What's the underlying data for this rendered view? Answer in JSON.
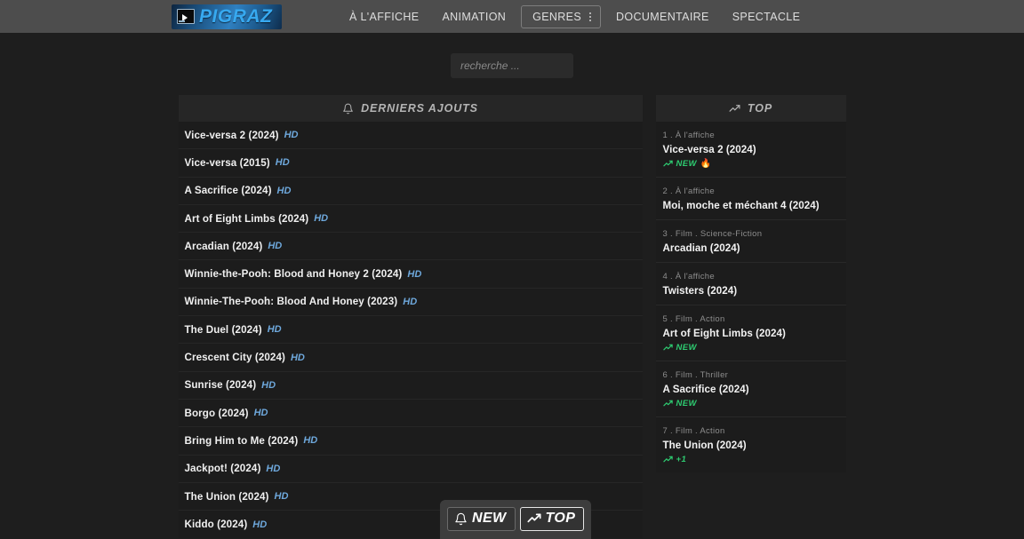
{
  "header": {
    "logo": {
      "text": "PIGRAZ",
      "icon": "monitor-play-icon"
    },
    "nav": [
      {
        "label": "À L'AFFICHE",
        "boxed": false
      },
      {
        "label": "ANIMATION",
        "boxed": false
      },
      {
        "label": "GENRES",
        "boxed": true,
        "icon": "kebab-menu-icon"
      },
      {
        "label": "DOCUMENTAIRE",
        "boxed": false
      },
      {
        "label": "SPECTACLE",
        "boxed": false
      }
    ]
  },
  "search": {
    "value": "",
    "placeholder": "recherche ..."
  },
  "latest": {
    "heading": "DERNIERS AJOUTS",
    "heading_icon": "bell-icon",
    "items": [
      {
        "title": "Vice-versa 2 (2024)",
        "quality": "HD"
      },
      {
        "title": "Vice-versa (2015)",
        "quality": "HD"
      },
      {
        "title": "A Sacrifice (2024)",
        "quality": "HD"
      },
      {
        "title": "Art of Eight Limbs (2024)",
        "quality": "HD"
      },
      {
        "title": "Arcadian (2024)",
        "quality": "HD"
      },
      {
        "title": "Winnie-the-Pooh: Blood and Honey 2 (2024)",
        "quality": "HD"
      },
      {
        "title": "Winnie-The-Pooh: Blood And Honey (2023)",
        "quality": "HD"
      },
      {
        "title": "The Duel (2024)",
        "quality": "HD"
      },
      {
        "title": "Crescent City (2024)",
        "quality": "HD"
      },
      {
        "title": "Sunrise (2024)",
        "quality": "HD"
      },
      {
        "title": "Borgo (2024)",
        "quality": "HD"
      },
      {
        "title": "Bring Him to Me (2024)",
        "quality": "HD"
      },
      {
        "title": "Jackpot! (2024)",
        "quality": "HD"
      },
      {
        "title": "The Union (2024)",
        "quality": "HD"
      },
      {
        "title": "Kiddo (2024)",
        "quality": "HD"
      }
    ]
  },
  "top": {
    "heading": "TOP",
    "heading_icon": "trending-up-icon",
    "items": [
      {
        "meta": "1 . À l'affiche",
        "title": "Vice-versa 2 (2024)",
        "badge": "NEW",
        "badge_icon": "trending-up-icon",
        "fire": "🔥"
      },
      {
        "meta": "2 . À l'affiche",
        "title": "Moi, moche et méchant 4 (2024)",
        "badge": "",
        "badge_icon": "",
        "fire": ""
      },
      {
        "meta": "3 . Film . Science-Fiction",
        "title": "Arcadian (2024)",
        "badge": "",
        "badge_icon": "",
        "fire": ""
      },
      {
        "meta": "4 . À l'affiche",
        "title": "Twisters (2024)",
        "badge": "",
        "badge_icon": "",
        "fire": ""
      },
      {
        "meta": "5 . Film . Action",
        "title": "Art of Eight Limbs (2024)",
        "badge": "NEW",
        "badge_icon": "trending-up-icon",
        "fire": ""
      },
      {
        "meta": "6 . Film . Thriller",
        "title": "A Sacrifice (2024)",
        "badge": "NEW",
        "badge_icon": "trending-up-icon",
        "fire": ""
      },
      {
        "meta": "7 . Film . Action",
        "title": "The Union (2024)",
        "badge": "+1",
        "badge_icon": "trending-up-icon",
        "fire": ""
      }
    ]
  },
  "floatbar": {
    "buttons": [
      {
        "label": "NEW",
        "icon": "bell-icon",
        "active": false
      },
      {
        "label": "TOP",
        "icon": "trending-up-icon",
        "active": true
      }
    ]
  },
  "colors": {
    "header_bg": "#4d4d4d",
    "page_bg": "#1e1e1e",
    "panel_bg": "#1c1c1c",
    "panel_head_bg": "#262626",
    "accent_blue": "#37a9f0",
    "quality_blue": "#6ea8dc",
    "badge_green": "#2ecc71"
  }
}
